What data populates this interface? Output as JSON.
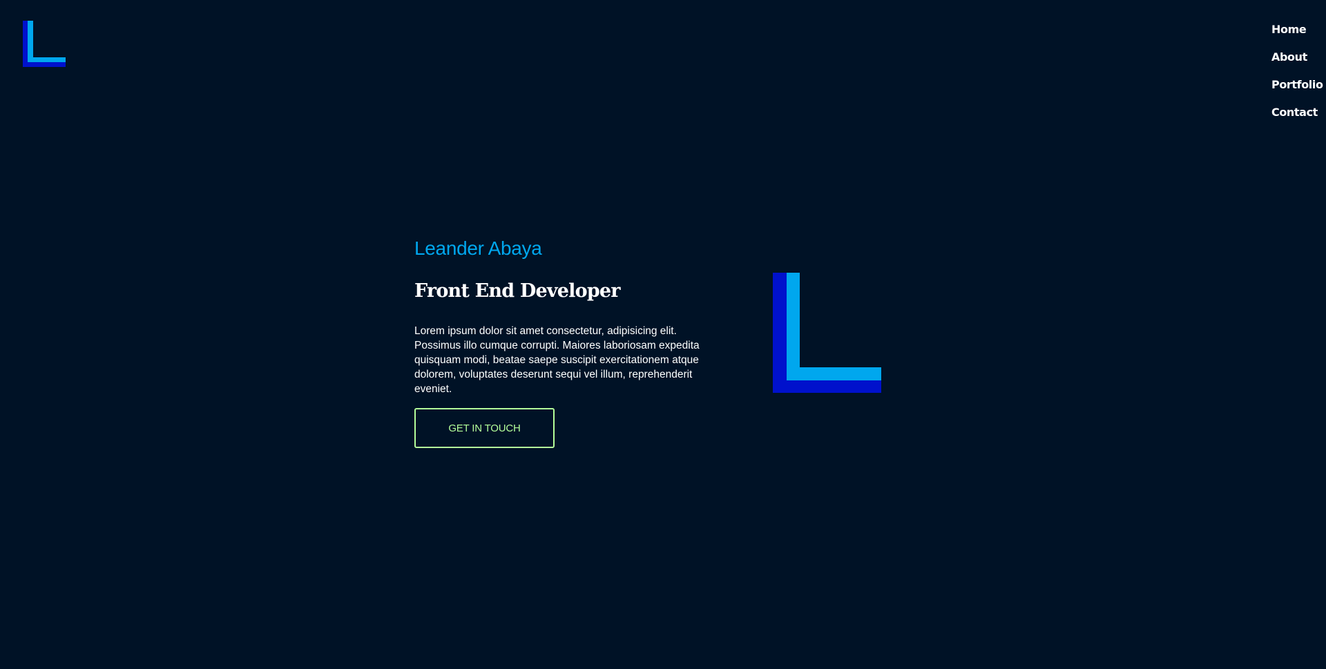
{
  "colors": {
    "background": "#001226",
    "accent_light_blue": "#00a7ee",
    "accent_dark_blue": "#0011cc",
    "cta_green": "#b4ff9a",
    "text": "#ffffff"
  },
  "header": {
    "logo_icon": "L-logo-icon"
  },
  "nav": {
    "items": [
      {
        "label": "Home"
      },
      {
        "label": "About"
      },
      {
        "label": "Portfolio"
      },
      {
        "label": "Contact"
      }
    ]
  },
  "hero": {
    "name": "Leander Abaya",
    "title": "Front End Developer",
    "description": "Lorem ipsum dolor sit amet consectetur, adipisicing elit. Possimus illo cumque corrupti. Maiores laboriosam expedita quisquam modi, beatae saepe suscipit exercitationem atque dolorem, voluptates deserunt sequi vel illum, reprehenderit eveniet.",
    "cta_label": "GET IN TOUCH",
    "mark_icon": "L-logo-mark-icon"
  }
}
